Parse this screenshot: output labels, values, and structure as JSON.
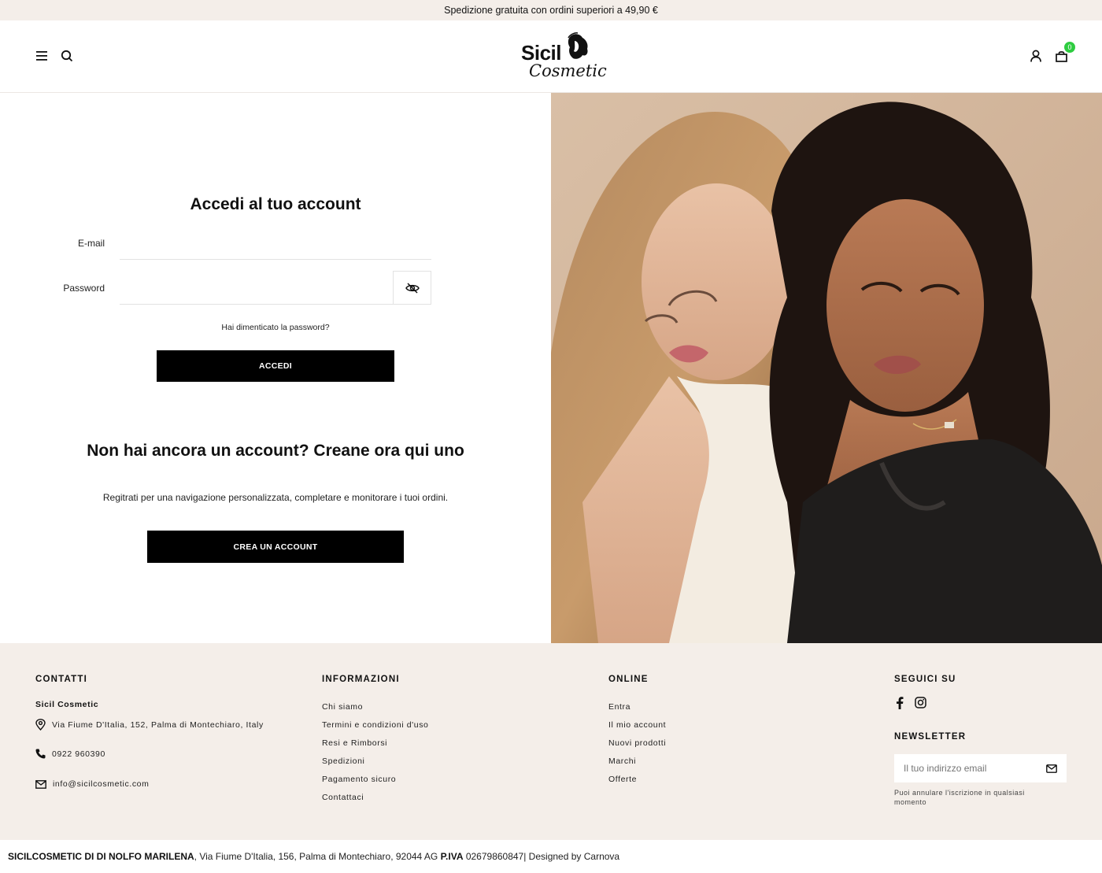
{
  "announcement": "Spedizione gratuita con ordini superiori a 49,90 €",
  "header": {
    "logo_line1": "Sicil",
    "logo_line2": "Cosmetic",
    "cart_count": "0"
  },
  "login": {
    "title": "Accedi al tuo account",
    "email_label": "E-mail",
    "email_value": "",
    "password_label": "Password",
    "password_value": "",
    "forgot": "Hai dimenticato la password?",
    "submit": "ACCEDI"
  },
  "register": {
    "title": "Non hai ancora un account? Creane ora qui uno",
    "description": "Regitrati per una navigazione personalizzata, completare e monitorare i tuoi ordini.",
    "button": "CREA UN ACCOUNT"
  },
  "footer": {
    "contacts": {
      "heading": "CONTATTI",
      "company": "Sicil Cosmetic",
      "address": "Via Fiume D'Italia, 152, Palma di Montechiaro, Italy",
      "phone": "0922 960390",
      "email": "info@sicilcosmetic.com"
    },
    "info": {
      "heading": "INFORMAZIONI",
      "links": [
        "Chi siamo",
        "Termini e condizioni d'uso",
        "Resi e Rimborsi",
        "Spedizioni",
        "Pagamento sicuro",
        "Contattaci"
      ]
    },
    "online": {
      "heading": "ONLINE",
      "links": [
        "Entra",
        "Il mio account",
        "Nuovi prodotti",
        "Marchi",
        "Offerte"
      ]
    },
    "social": {
      "heading": "SEGUICI SU"
    },
    "newsletter": {
      "heading": "NEWSLETTER",
      "placeholder": "Il tuo indirizzo email",
      "note": "Puoi annulare l'iscrizione in qualsiasi momento"
    }
  },
  "bottom_bar": {
    "company": "SICILCOSMETIC DI DI NOLFO MARILENA",
    "address": ", Via Fiume D'Italia, 156, Palma di Montechiaro, 92044 AG ",
    "vat_label": "P.IVA",
    "vat_value": " 02679860847",
    "designer": "| Designed by Carnova"
  },
  "colors": {
    "beige": "#f4eee9",
    "black": "#000000",
    "badge_green": "#2ecc40"
  }
}
